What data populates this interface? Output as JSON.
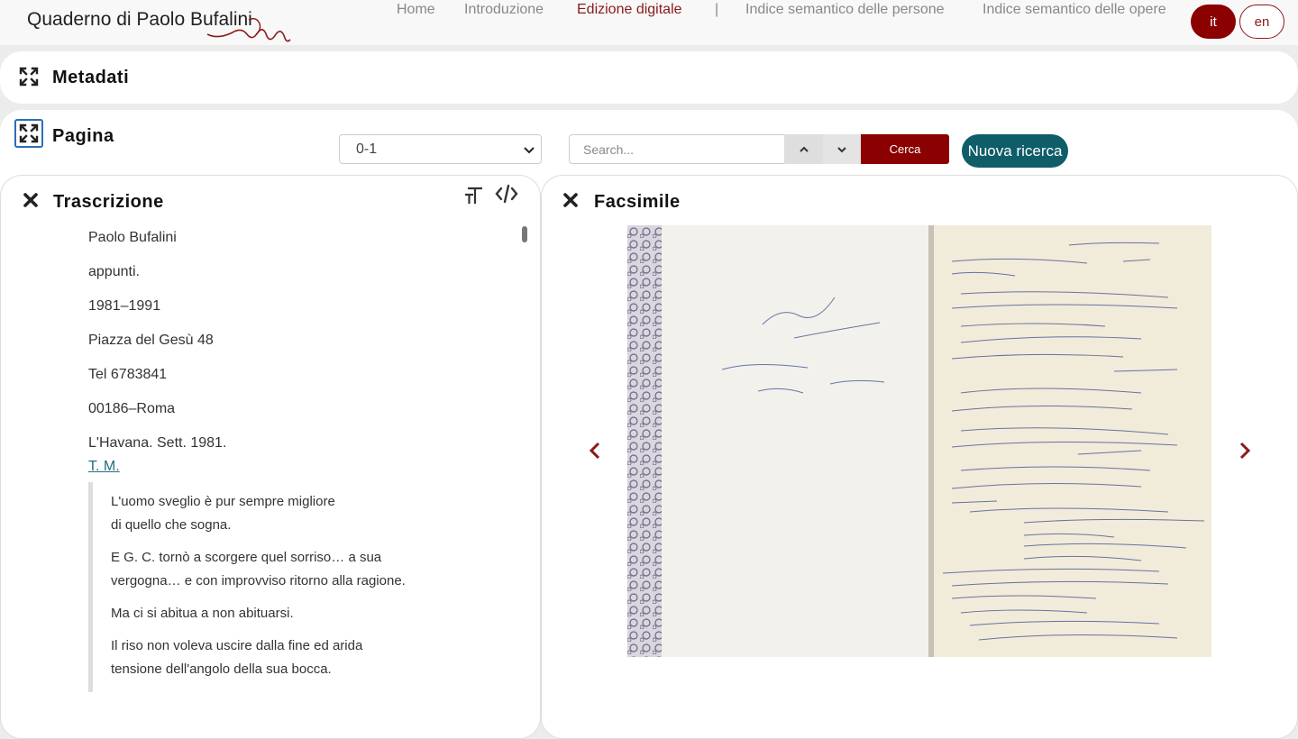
{
  "header": {
    "brand": "Quaderno di Paolo Bufalini",
    "nav": [
      {
        "label": "Home"
      },
      {
        "label": "Introduzione"
      },
      {
        "label": "Edizione digitale"
      },
      {
        "label": "|"
      },
      {
        "label": "Indice semantico delle persone"
      },
      {
        "label": "Indice semantico delle opere"
      }
    ],
    "lang_it": "it",
    "lang_en": "en"
  },
  "metadati": {
    "title": "Metadati"
  },
  "pagina": {
    "title": "Pagina",
    "page_select": "0-1",
    "search_placeholder": "Search...",
    "cerca_label": "Cerca",
    "nuova_label": "Nuova ricerca"
  },
  "trascrizione": {
    "title": "Trascrizione",
    "lines": [
      "Paolo Bufalini",
      "appunti.",
      "1981–1991",
      "Piazza del Gesù 48",
      "Tel 6783841",
      "00186–Roma",
      "L'Havana. Sett. 1981."
    ],
    "link": "T. M.",
    "quote": [
      "L'uomo sveglio è pur sempre migliore",
      "di quello che sogna.",
      "E G. C. tornò a scorgere quel sorriso… a sua",
      "vergogna… e con improvviso ritorno alla ragione.",
      "Ma ci si abitua a non abituarsi.",
      "Il riso non voleva uscire dalla fine ed arida",
      "tensione dell'angolo della sua bocca."
    ]
  },
  "facsimile": {
    "title": "Facsimile"
  },
  "colors": {
    "accent": "#8b0000",
    "teal": "#0e5d69",
    "link": "#1f6f83"
  }
}
